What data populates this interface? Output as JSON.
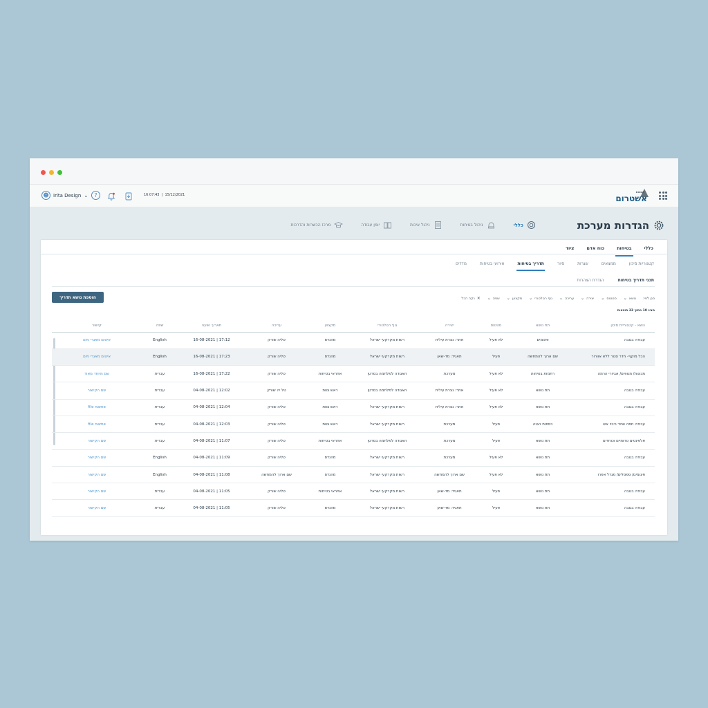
{
  "topbar": {
    "user_name": "Irita Design",
    "time": "16:07:43",
    "date": "15/12/2021",
    "logo_main": "אשטרום",
    "logo_sub": "קבוצת"
  },
  "page": {
    "title": "הגדרות מערכת",
    "modules": [
      {
        "label": "כללי",
        "icon": "gear-icon",
        "active": true
      },
      {
        "label": "ניהול בטיחות",
        "icon": "helmet-icon"
      },
      {
        "label": "ניהול איכות",
        "icon": "clipboard-icon"
      },
      {
        "label": "יומן עבודה",
        "icon": "book-icon"
      },
      {
        "label": "מרכז הכשרות והדרכות",
        "icon": "graduation-cap-icon"
      }
    ]
  },
  "tabs_primary": [
    "כללי",
    "בטיחות",
    "כוח אדם",
    "ציוד"
  ],
  "tabs_secondary": [
    "קטגוריות סיכון",
    "ממצאים",
    "שגרות",
    "סיור",
    "תדריך בטיחות",
    "אירועי בטיחות",
    "מדדים"
  ],
  "tabs_tertiary": [
    "תכני תדריך בטיחות",
    "הגדרת הצהרות"
  ],
  "add_button": "הוספת נושא תדריך",
  "filters": {
    "label": "סנן לפי:",
    "items": [
      "נושא",
      "סטטוס",
      "יצירה",
      "עריכה",
      "גוף רגולטורי",
      "מקצוע",
      "שפה"
    ],
    "clear": "נקה הכל"
  },
  "results_text": "מציג 10 מתוך 33 תוצאות",
  "table": {
    "headers": [
      "נושא - קטגוריית סיכון",
      "תת נושא",
      "סטטוס",
      "יצירה",
      "גוף רגולטורי",
      "מקצוע",
      "עריכה",
      "תאריך ושעה",
      "שפה",
      "קישור"
    ],
    "rows": [
      [
        "עבודה בגובה",
        "פיגומים",
        "לא פעיל",
        "אתר: נצרת עילית",
        "רשות מקרקעי ישראל",
        "מהנדס",
        "טליה שורק",
        "17:12 | 16-08-2021",
        "English",
        "איטום מאגרי מים"
      ],
      [
        "הכל מוקף- חדר סגור ללא אוורור",
        "שם ארוך להמחשה",
        "פעיל",
        "תאגיד: מד-שאן",
        "רשות מקרקעי ישראל",
        "מהנדס",
        "טליה שורק",
        "17:23 | 16-08-2021",
        "English",
        "איטום מאגרי מים"
      ],
      [
        "מכונות/ מנופים/ אביזרי הרמה",
        "רתמות בטיחות",
        "לא פעיל",
        "מערכת",
        "האגודה למלחמה בסרטן",
        "אחראי בטיחות",
        "טליה שורק",
        "17:22 | 16-08-2021",
        "עברית",
        "שם מיוחד מאוד"
      ],
      [
        "עבודה בגובה",
        "תת נושא",
        "לא פעיל",
        "אתר: נצרת עילית",
        "האגודה למלחמה בסרטן",
        "ראש צוות",
        "טל יה שורק",
        "12:02 | 04-08-2021",
        "עברית",
        "שם הקישור"
      ],
      [
        "עבודה בגובה",
        "תת נושא",
        "לא פעיל",
        "אתר: נצרת עילית",
        "רשות מקרקעי ישראל",
        "ראש צוות",
        "טליה שורק",
        "12:04 | 04-08-2021",
        "עברית",
        "file name"
      ],
      [
        "עבודה חמה וציוד כיבוי אש",
        "כפפות הגנה",
        "פעיל",
        "מערכת",
        "רשות מקרקעי ישראל",
        "ראש צוות",
        "טליה שורק",
        "12:03 | 04-08-2021",
        "עברית",
        "file name"
      ],
      [
        "אלפינטים טרומיים וכוחדים",
        "תת נושא",
        "פעיל",
        "מערכת",
        "האגודה למלחמה בסרטן",
        "אחראי בטיחות",
        "טליה שורק",
        "11:07 | 04-08-2021",
        "עברית",
        "שם הקישור"
      ],
      [
        "עבודה בגובה",
        "תת נושא",
        "לא פעיל",
        "מערכת",
        "רשות מקרקעי ישראל",
        "מהנדס",
        "טליה שורק",
        "11:09 | 04-08-2021",
        "English",
        "שם הקישור"
      ],
      [
        "פיגומים/ ספסלים/ מגדל אפרו",
        "תת נושא",
        "לא פעיל",
        "שם ארוך להמחשה",
        "רשות מקרקעי ישראל",
        "מהנדס",
        "שם ארוך להמחשה",
        "11:08 | 04-08-2021",
        "English",
        "שם הקישור"
      ],
      [
        "עבודה בגובה",
        "תת נושא",
        "פעיל",
        "תאגיד: מד-שאן",
        "רשות מקרקעי ישראל",
        "אחראי בטיחות",
        "טליה שורק",
        "11:05 | 04-08-2021",
        "עברית",
        "שם הקישור"
      ],
      [
        "עבודה בגובה",
        "תת נושא",
        "פעיל",
        "תאגיד: מד-שאן",
        "רשות מקרקעי ישראל",
        "מהנדס",
        "טליה שורק",
        "11:05 | 04-08-2021",
        "עברית",
        "שם הקישור"
      ]
    ]
  },
  "colors": {
    "accent": "#2f7fbd",
    "button": "#3e6680",
    "link": "#4a94cf",
    "background": "#abc7d6"
  }
}
